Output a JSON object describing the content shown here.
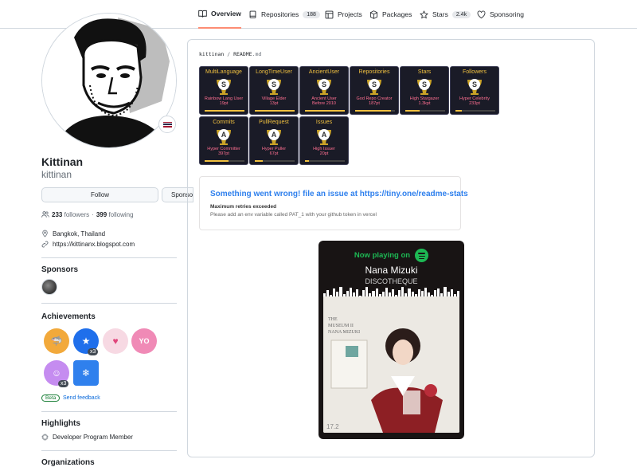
{
  "nav": {
    "tabs": [
      {
        "label": "Overview",
        "icon": "book-icon",
        "active": true
      },
      {
        "label": "Repositories",
        "icon": "repo-icon",
        "count": "188"
      },
      {
        "label": "Projects",
        "icon": "table-icon"
      },
      {
        "label": "Packages",
        "icon": "package-icon"
      },
      {
        "label": "Stars",
        "icon": "star-icon",
        "count": "2.4k"
      },
      {
        "label": "Sponsoring",
        "icon": "heart-icon"
      }
    ]
  },
  "profile": {
    "name": "Kittinan",
    "login": "kittinan",
    "follow_label": "Follow",
    "sponsor_label": "Sponsor",
    "followers_count": "233",
    "followers_label": "followers",
    "separator": "·",
    "following_count": "399",
    "following_label": "following",
    "location": "Bangkok, Thailand",
    "website": "https://kittinanx.blogspot.com"
  },
  "sponsors": {
    "title": "Sponsors"
  },
  "achievements": {
    "title": "Achievements",
    "items": [
      {
        "icon": "pull-shark-icon",
        "color": "#f2a93b"
      },
      {
        "icon": "starstruck-icon",
        "color": "#1f6feb",
        "multiplier": "x3"
      },
      {
        "icon": "heart-on-sleeve-icon",
        "color": "#f7b6c8"
      },
      {
        "icon": "yolo-icon",
        "color": "#f08ab6"
      },
      {
        "icon": "quickdraw-icon",
        "color": "#c58cf0",
        "multiplier": "x3"
      },
      {
        "icon": "arctic-code-vault-icon",
        "color": "#2f80ed"
      }
    ],
    "beta_label": "Beta",
    "feedback_label": "Send feedback"
  },
  "highlights": {
    "title": "Highlights",
    "item": "Developer Program Member"
  },
  "organizations": {
    "title": "Organizations"
  },
  "readme": {
    "path_user": "kittinan",
    "path_sep": "/",
    "path_file": "README",
    "path_ext": ".md",
    "trophies": [
      {
        "title": "MultiLanguage",
        "rank": "S",
        "subtitle": "Rainbow Lang User",
        "points": "19pt",
        "progress": 1.0
      },
      {
        "title": "LongTimeUser",
        "rank": "S",
        "subtitle": "Village Elder",
        "points": "13pt",
        "progress": 1.0
      },
      {
        "title": "AncientUser",
        "rank": "S",
        "subtitle": "Ancient User",
        "points": "Before 2010",
        "progress": 1.0
      },
      {
        "title": "Repositories",
        "rank": "S",
        "subtitle": "God Repo Creator",
        "points": "187pt",
        "progress": 0.9
      },
      {
        "title": "Stars",
        "rank": "S",
        "subtitle": "High Stargazer",
        "points": "1.3kpt",
        "progress": 0.35
      },
      {
        "title": "Followers",
        "rank": "S",
        "subtitle": "Hyper Celebrity",
        "points": "233pt",
        "progress": 0.15
      },
      {
        "title": "Commits",
        "rank": "A",
        "subtitle": "Hyper Committer",
        "points": "397pt",
        "progress": 0.6
      },
      {
        "title": "PullRequest",
        "rank": "A",
        "subtitle": "Hyper Puller",
        "points": "67pt",
        "progress": 0.2
      },
      {
        "title": "Issues",
        "rank": "A",
        "subtitle": "High Issuer",
        "points": "20pt",
        "progress": 0.1
      }
    ],
    "error": {
      "title": "Something went wrong! file an issue at https://tiny.one/readme-stats",
      "line1": "Maximum retries exceeded",
      "line2": "Please add an env variable called PAT_1 with your github token in vercel"
    },
    "spotify": {
      "now_playing": "Now playing on",
      "artist": "Nana Mizuki",
      "song": "DISCOTHEQUE",
      "cover_text_1": "THE",
      "cover_text_2": "MUSEUM II",
      "cover_text_3": "NANA MIZUKI",
      "cover_text_4": "17.2"
    }
  },
  "colors": {
    "accent": "#fd8c73",
    "link": "#0969da",
    "spotify": "#1db954",
    "trophy_bg": "#1a1b27"
  }
}
